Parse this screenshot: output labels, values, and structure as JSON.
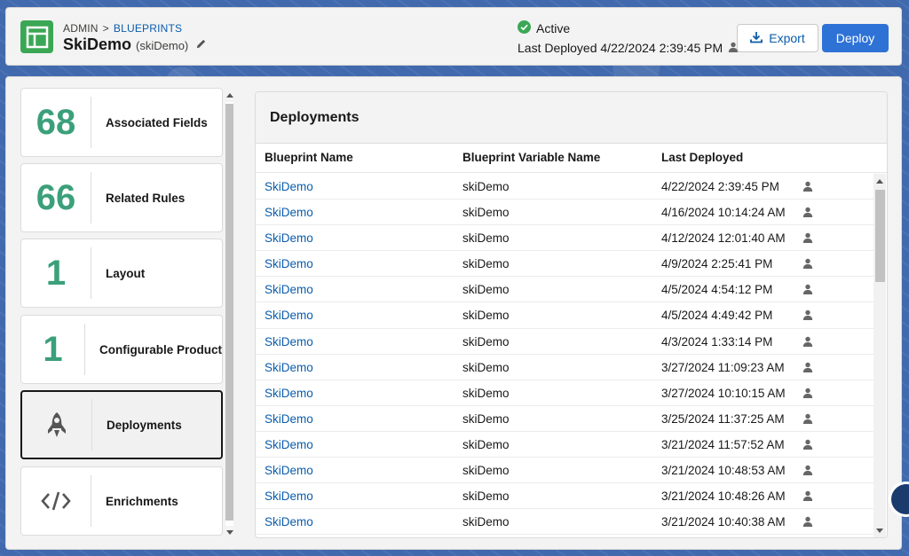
{
  "breadcrumb": {
    "root": "ADMIN",
    "separator": ">",
    "current": "BLUEPRINTS"
  },
  "header": {
    "title": "SkiDemo",
    "subtitle": "(skiDemo)",
    "status": "Active",
    "last_deployed": "Last Deployed 4/22/2024 2:39:45 PM",
    "export_label": "Export",
    "deploy_label": "Deploy"
  },
  "cards": [
    {
      "value": "68",
      "label": "Associated Fields",
      "icon": null
    },
    {
      "value": "66",
      "label": "Related Rules",
      "icon": null
    },
    {
      "value": "1",
      "label": "Layout",
      "icon": null
    },
    {
      "value": "1",
      "label": "Configurable Product",
      "icon": null
    },
    {
      "value": null,
      "label": "Deployments",
      "icon": "rocket-icon",
      "active": true
    },
    {
      "value": null,
      "label": "Enrichments",
      "icon": "code-icon"
    }
  ],
  "deployments": {
    "title": "Deployments",
    "columns": [
      "Blueprint Name",
      "Blueprint Variable Name",
      "Last Deployed"
    ],
    "rows": [
      {
        "name": "SkiDemo",
        "variable": "skiDemo",
        "deployed": "4/22/2024 2:39:45 PM"
      },
      {
        "name": "SkiDemo",
        "variable": "skiDemo",
        "deployed": "4/16/2024 10:14:24 AM"
      },
      {
        "name": "SkiDemo",
        "variable": "skiDemo",
        "deployed": "4/12/2024 12:01:40 AM"
      },
      {
        "name": "SkiDemo",
        "variable": "skiDemo",
        "deployed": "4/9/2024 2:25:41 PM"
      },
      {
        "name": "SkiDemo",
        "variable": "skiDemo",
        "deployed": "4/5/2024 4:54:12 PM"
      },
      {
        "name": "SkiDemo",
        "variable": "skiDemo",
        "deployed": "4/5/2024 4:49:42 PM"
      },
      {
        "name": "SkiDemo",
        "variable": "skiDemo",
        "deployed": "4/3/2024 1:33:14 PM"
      },
      {
        "name": "SkiDemo",
        "variable": "skiDemo",
        "deployed": "3/27/2024 11:09:23 AM"
      },
      {
        "name": "SkiDemo",
        "variable": "skiDemo",
        "deployed": "3/27/2024 10:10:15 AM"
      },
      {
        "name": "SkiDemo",
        "variable": "skiDemo",
        "deployed": "3/25/2024 11:37:25 AM"
      },
      {
        "name": "SkiDemo",
        "variable": "skiDemo",
        "deployed": "3/21/2024 11:57:52 AM"
      },
      {
        "name": "SkiDemo",
        "variable": "skiDemo",
        "deployed": "3/21/2024 10:48:53 AM"
      },
      {
        "name": "SkiDemo",
        "variable": "skiDemo",
        "deployed": "3/21/2024 10:48:26 AM"
      },
      {
        "name": "SkiDemo",
        "variable": "skiDemo",
        "deployed": "3/21/2024 10:40:38 AM"
      }
    ]
  },
  "colors": {
    "accent": "#2e72d6",
    "link": "#0b5cab",
    "success": "#3ba755",
    "metric": "#3ba07a"
  }
}
